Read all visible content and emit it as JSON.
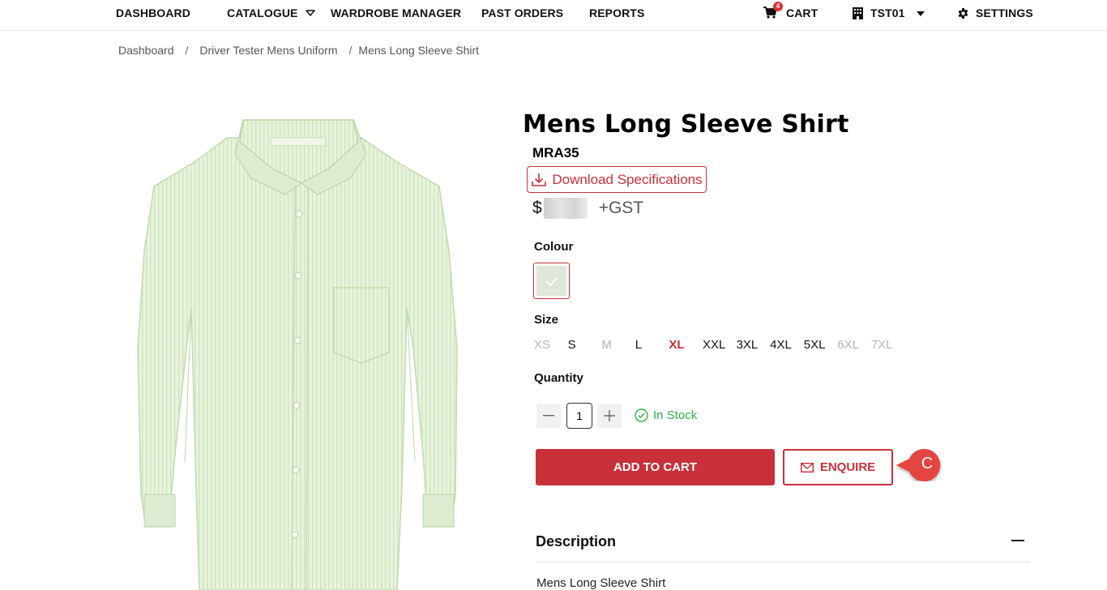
{
  "nav": {
    "dashboard": "DASHBOARD",
    "catalogue": "CATALOGUE",
    "wardrobe_manager": "WARDROBE MANAGER",
    "past_orders": "PAST ORDERS",
    "reports": "REPORTS",
    "cart": "CART",
    "cart_count": "4",
    "account": "TST01",
    "settings": "SETTINGS"
  },
  "breadcrumb": {
    "items": [
      "Dashboard",
      "Driver Tester Mens Uniform",
      "Mens Long Sleeve Shirt"
    ],
    "separator": "/"
  },
  "product": {
    "title": "Mens Long Sleeve Shirt",
    "sku": "MRA35",
    "download_label": "Download Specifications",
    "currency_symbol": "$",
    "gst_label": "+GST",
    "colour_label": "Colour",
    "colour_swatch": "#dfe7da",
    "size_label": "Size",
    "sizes": [
      {
        "label": "XS",
        "state": "disabled"
      },
      {
        "label": "S",
        "state": "available"
      },
      {
        "label": "M",
        "state": "disabled"
      },
      {
        "label": "L",
        "state": "available"
      },
      {
        "label": "XL",
        "state": "selected"
      },
      {
        "label": "XXL",
        "state": "available"
      },
      {
        "label": "3XL",
        "state": "available"
      },
      {
        "label": "4XL",
        "state": "available"
      },
      {
        "label": "5XL",
        "state": "available"
      },
      {
        "label": "6XL",
        "state": "disabled"
      },
      {
        "label": "7XL",
        "state": "disabled"
      }
    ],
    "quantity_label": "Quantity",
    "quantity_value": "1",
    "stock_status": "In Stock",
    "add_to_cart_label": "ADD TO CART",
    "enquire_label": "ENQUIRE",
    "description_title": "Description",
    "description_text": "Mens Long Sleeve Shirt"
  },
  "callout": {
    "label": "C"
  },
  "colors": {
    "accent": "#c9303a",
    "in_stock": "#2db24a",
    "disabled": "#b5b5b5"
  }
}
